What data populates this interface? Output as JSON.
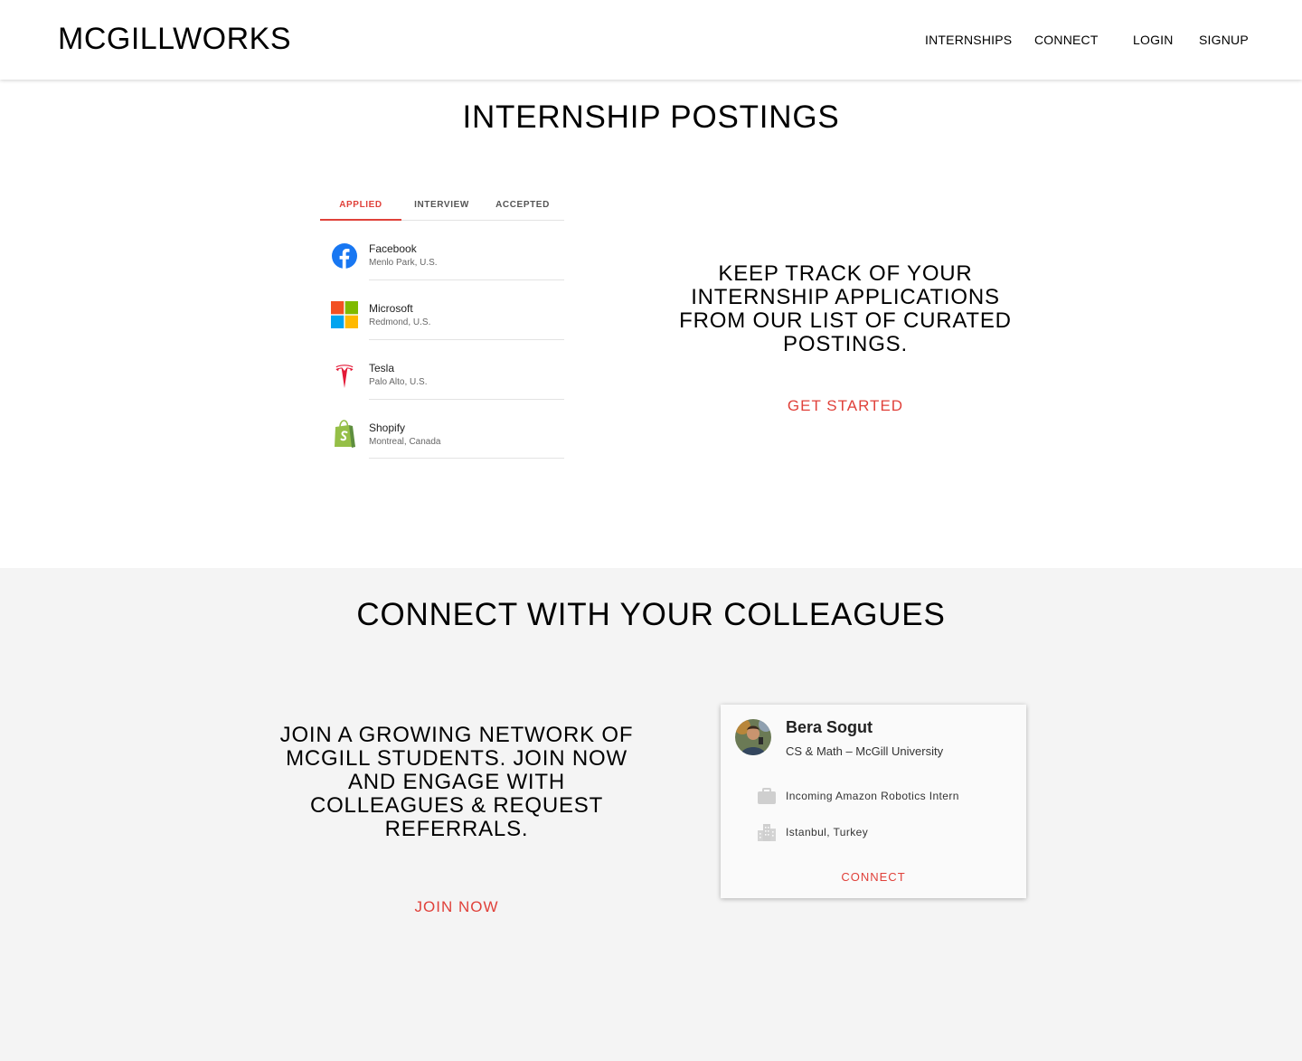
{
  "header": {
    "brand": "MCGILLWORKS",
    "nav": [
      "INTERNSHIPS",
      "CONNECT",
      "LOGIN",
      "SIGNUP"
    ]
  },
  "postings": {
    "title": "INTERNSHIP POSTINGS",
    "tabs": [
      "APPLIED",
      "INTERVIEW",
      "ACCEPTED"
    ],
    "active_tab": "APPLIED",
    "companies": [
      {
        "name": "Facebook",
        "location": "Menlo Park, U.S.",
        "icon": "facebook-logo-icon"
      },
      {
        "name": "Microsoft",
        "location": "Redmond, U.S.",
        "icon": "microsoft-logo-icon"
      },
      {
        "name": "Tesla",
        "location": "Palo Alto, U.S.",
        "icon": "tesla-logo-icon"
      },
      {
        "name": "Shopify",
        "location": "Montreal, Canada",
        "icon": "shopify-logo-icon"
      }
    ],
    "description_lines": [
      "KEEP TRACK OF YOUR",
      "INTERNSHIP APPLICATIONS",
      "FROM OUR LIST OF CURATED",
      "POSTINGS."
    ],
    "cta": "GET STARTED"
  },
  "connect": {
    "title": "CONNECT WITH YOUR COLLEAGUES",
    "description_lines": [
      "JOIN A GROWING NETWORK OF",
      "MCGILL STUDENTS. JOIN NOW",
      "AND ENGAGE WITH",
      "COLLEAGUES & REQUEST",
      "REFERRALS."
    ],
    "cta": "JOIN NOW",
    "profile": {
      "name": "Bera Sogut",
      "meta": "CS & Math – McGill University",
      "position": "Incoming Amazon Robotics Intern",
      "location": "Istanbul, Turkey",
      "button": "CONNECT"
    }
  },
  "colors": {
    "accent": "#e0413a",
    "section_bg": "#f4f4f4"
  }
}
